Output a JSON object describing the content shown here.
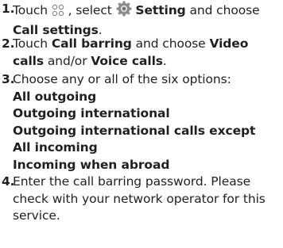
{
  "steps": [
    {
      "number": "1.",
      "text_a": " Touch ",
      "icon_1": "app-grid-icon",
      "text_b": " , select ",
      "icon_2": "settings-gear-icon",
      "bold_a": "Setting",
      "text_c": " and choose ",
      "bold_b": "Call settings",
      "text_d": "."
    },
    {
      "number": "2.",
      "text_a": " Touch ",
      "bold_a": "Call barring",
      "text_b": " and choose ",
      "bold_b": "Video calls",
      "text_c": " and/or ",
      "bold_c": "Voice calls",
      "text_d": "."
    },
    {
      "number": "3.",
      "text_a": " Choose any or all of the six options:",
      "options": [
        "All outgoing",
        "Outgoing international",
        "Outgoing international calls except",
        "All incoming",
        "Incoming when abroad"
      ]
    },
    {
      "number": "4.",
      "text_a": " Enter the call barring password. Please check with your network operator for this service."
    }
  ],
  "colors": {
    "text": "#231f20",
    "icon_gray": "#8a8a8a"
  }
}
